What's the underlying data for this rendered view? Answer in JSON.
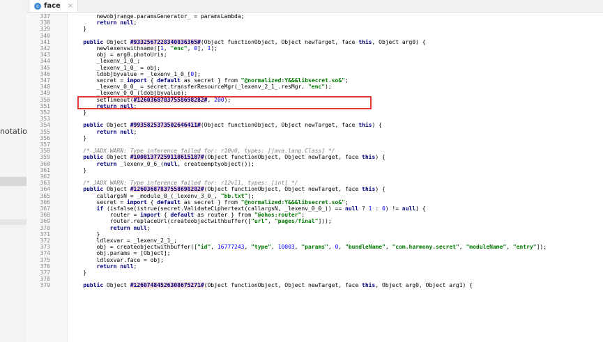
{
  "sidebar": {
    "partial_label": "notatio"
  },
  "tab": {
    "icon": "c",
    "label": "face",
    "close": "×"
  },
  "lines": [
    {
      "n": "337",
      "segs": [
        {
          "t": "        newobjrange.paramsGenerator_ = paramsLambda;",
          "c": ""
        }
      ]
    },
    {
      "n": "338",
      "segs": [
        {
          "t": "        ",
          "c": ""
        },
        {
          "t": "return null",
          "c": "kw"
        },
        {
          "t": ";",
          "c": ""
        }
      ]
    },
    {
      "n": "339",
      "segs": [
        {
          "t": "    }",
          "c": ""
        }
      ]
    },
    {
      "n": "340",
      "segs": [
        {
          "t": "",
          "c": ""
        }
      ]
    },
    {
      "n": "341",
      "segs": [
        {
          "t": "    ",
          "c": ""
        },
        {
          "t": "public",
          "c": "kw"
        },
        {
          "t": " Object ",
          "c": ""
        },
        {
          "t": "#9332567228340836365#",
          "c": "hl"
        },
        {
          "t": "(Object functionObject, Object newTarget, face ",
          "c": ""
        },
        {
          "t": "this",
          "c": "kw"
        },
        {
          "t": ", Object arg0) {",
          "c": ""
        }
      ]
    },
    {
      "n": "342",
      "segs": [
        {
          "t": "        newlexenvwithname([",
          "c": ""
        },
        {
          "t": "1",
          "c": "num"
        },
        {
          "t": ", ",
          "c": ""
        },
        {
          "t": "\"enc\"",
          "c": "str"
        },
        {
          "t": ", ",
          "c": ""
        },
        {
          "t": "0",
          "c": "num"
        },
        {
          "t": "], ",
          "c": ""
        },
        {
          "t": "1",
          "c": "num"
        },
        {
          "t": ");",
          "c": ""
        }
      ]
    },
    {
      "n": "343",
      "segs": [
        {
          "t": "        obj = arg0.photoUris;",
          "c": ""
        }
      ]
    },
    {
      "n": "344",
      "segs": [
        {
          "t": "        _lexenv_1_0_;",
          "c": ""
        }
      ]
    },
    {
      "n": "345",
      "segs": [
        {
          "t": "        _lexenv_1_0_ = obj;",
          "c": ""
        }
      ]
    },
    {
      "n": "346",
      "segs": [
        {
          "t": "        ldobjbyvalue = _lexenv_1_0_[",
          "c": ""
        },
        {
          "t": "0",
          "c": "num"
        },
        {
          "t": "];",
          "c": ""
        }
      ]
    },
    {
      "n": "347",
      "segs": [
        {
          "t": "        secret = ",
          "c": ""
        },
        {
          "t": "import",
          "c": "kw"
        },
        {
          "t": " { ",
          "c": ""
        },
        {
          "t": "default",
          "c": "kw"
        },
        {
          "t": " as secret } from ",
          "c": ""
        },
        {
          "t": "\"@normalized:Y&&&libsecret.so&\"",
          "c": "str"
        },
        {
          "t": ";",
          "c": ""
        }
      ]
    },
    {
      "n": "348",
      "segs": [
        {
          "t": "        _lexenv_0_0_ = secret.transferResourceMgr(_lexenv_2_1_.resMgr, ",
          "c": ""
        },
        {
          "t": "\"enc\"",
          "c": "str"
        },
        {
          "t": ");",
          "c": ""
        }
      ]
    },
    {
      "n": "349",
      "segs": [
        {
          "t": "        _lexenv_0_0_(ldobjbyvalue);",
          "c": ""
        }
      ]
    },
    {
      "n": "350",
      "segs": [
        {
          "t": "        setTimeout(",
          "c": ""
        },
        {
          "t": "#12603687837558698282#",
          "c": "hl"
        },
        {
          "t": ", ",
          "c": ""
        },
        {
          "t": "200",
          "c": "num"
        },
        {
          "t": ");",
          "c": ""
        }
      ]
    },
    {
      "n": "351",
      "segs": [
        {
          "t": "        ",
          "c": ""
        },
        {
          "t": "return null",
          "c": "kw"
        },
        {
          "t": ";",
          "c": ""
        }
      ]
    },
    {
      "n": "352",
      "segs": [
        {
          "t": "    }",
          "c": ""
        }
      ]
    },
    {
      "n": "353",
      "segs": [
        {
          "t": "",
          "c": ""
        }
      ]
    },
    {
      "n": "354",
      "segs": [
        {
          "t": "    ",
          "c": ""
        },
        {
          "t": "public",
          "c": "kw"
        },
        {
          "t": " Object ",
          "c": ""
        },
        {
          "t": "#9935825373502646411#",
          "c": "hl"
        },
        {
          "t": "(Object functionObject, Object newTarget, face ",
          "c": ""
        },
        {
          "t": "this",
          "c": "kw"
        },
        {
          "t": ") {",
          "c": ""
        }
      ]
    },
    {
      "n": "355",
      "segs": [
        {
          "t": "        ",
          "c": ""
        },
        {
          "t": "return null",
          "c": "kw"
        },
        {
          "t": ";",
          "c": ""
        }
      ]
    },
    {
      "n": "356",
      "segs": [
        {
          "t": "    }",
          "c": ""
        }
      ]
    },
    {
      "n": "357",
      "segs": [
        {
          "t": "",
          "c": ""
        }
      ]
    },
    {
      "n": "358",
      "segs": [
        {
          "t": "    /* JADX WARN: Type inference failed for: r10v0, types: [java.lang.Class] */",
          "c": "com"
        }
      ]
    },
    {
      "n": "359",
      "segs": [
        {
          "t": "    ",
          "c": ""
        },
        {
          "t": "public",
          "c": "kw"
        },
        {
          "t": " Object ",
          "c": ""
        },
        {
          "t": "#10081377259118615187#",
          "c": "hl"
        },
        {
          "t": "(Object functionObject, Object newTarget, face ",
          "c": ""
        },
        {
          "t": "this",
          "c": "kw"
        },
        {
          "t": ") {",
          "c": ""
        }
      ]
    },
    {
      "n": "360",
      "segs": [
        {
          "t": "        ",
          "c": ""
        },
        {
          "t": "return",
          "c": "kw"
        },
        {
          "t": " _lexenv_0_6_(",
          "c": ""
        },
        {
          "t": "null",
          "c": "kw"
        },
        {
          "t": ", createemptyobject());",
          "c": ""
        }
      ]
    },
    {
      "n": "361",
      "segs": [
        {
          "t": "    }",
          "c": ""
        }
      ]
    },
    {
      "n": "362",
      "segs": [
        {
          "t": "",
          "c": ""
        }
      ]
    },
    {
      "n": "363",
      "segs": [
        {
          "t": "    /* JADX WARN: Type inference failed for: r12v11, types: [int] */",
          "c": "com"
        }
      ]
    },
    {
      "n": "364",
      "segs": [
        {
          "t": "    ",
          "c": ""
        },
        {
          "t": "public",
          "c": "kw"
        },
        {
          "t": " Object ",
          "c": ""
        },
        {
          "t": "#12603687837558698282#",
          "c": "hl"
        },
        {
          "t": "(Object functionObject, Object newTarget, face ",
          "c": ""
        },
        {
          "t": "this",
          "c": "kw"
        },
        {
          "t": ") {",
          "c": ""
        }
      ]
    },
    {
      "n": "365",
      "segs": [
        {
          "t": "        callargsN = _module_0_(_lexenv_3_0_, ",
          "c": ""
        },
        {
          "t": "\"bb.txt\"",
          "c": "str"
        },
        {
          "t": ");",
          "c": ""
        }
      ]
    },
    {
      "n": "366",
      "segs": [
        {
          "t": "        secret = ",
          "c": ""
        },
        {
          "t": "import",
          "c": "kw"
        },
        {
          "t": " { ",
          "c": ""
        },
        {
          "t": "default",
          "c": "kw"
        },
        {
          "t": " as secret } from ",
          "c": ""
        },
        {
          "t": "\"@normalized:Y&&&libsecret.so&\"",
          "c": "str"
        },
        {
          "t": ";",
          "c": ""
        }
      ]
    },
    {
      "n": "367",
      "segs": [
        {
          "t": "        ",
          "c": ""
        },
        {
          "t": "if",
          "c": "kw"
        },
        {
          "t": " (isfalse(istrue(secret.ValidateCiphertext(callargsN, _lexenv_0_0_)) == ",
          "c": ""
        },
        {
          "t": "null",
          "c": "kw"
        },
        {
          "t": " ? ",
          "c": ""
        },
        {
          "t": "1",
          "c": "num"
        },
        {
          "t": " : ",
          "c": ""
        },
        {
          "t": "0",
          "c": "num"
        },
        {
          "t": ") != ",
          "c": ""
        },
        {
          "t": "null",
          "c": "kw"
        },
        {
          "t": ") {",
          "c": ""
        }
      ]
    },
    {
      "n": "368",
      "segs": [
        {
          "t": "            router = ",
          "c": ""
        },
        {
          "t": "import",
          "c": "kw"
        },
        {
          "t": " { ",
          "c": ""
        },
        {
          "t": "default",
          "c": "kw"
        },
        {
          "t": " as router } from ",
          "c": ""
        },
        {
          "t": "\"@ohos:router\"",
          "c": "str"
        },
        {
          "t": ";",
          "c": ""
        }
      ]
    },
    {
      "n": "369",
      "segs": [
        {
          "t": "            router.replaceUrl(createobjectwithbuffer([",
          "c": ""
        },
        {
          "t": "\"url\"",
          "c": "str"
        },
        {
          "t": ", ",
          "c": ""
        },
        {
          "t": "\"pages/final\"",
          "c": "str"
        },
        {
          "t": "]));",
          "c": ""
        }
      ]
    },
    {
      "n": "370",
      "segs": [
        {
          "t": "            ",
          "c": ""
        },
        {
          "t": "return null",
          "c": "kw"
        },
        {
          "t": ";",
          "c": ""
        }
      ]
    },
    {
      "n": "371",
      "segs": [
        {
          "t": "        }",
          "c": ""
        }
      ]
    },
    {
      "n": "372",
      "segs": [
        {
          "t": "        ldlexvar = _lexenv_2_1_;",
          "c": ""
        }
      ]
    },
    {
      "n": "373",
      "segs": [
        {
          "t": "        obj = createobjectwithbuffer([",
          "c": ""
        },
        {
          "t": "\"id\"",
          "c": "str"
        },
        {
          "t": ", ",
          "c": ""
        },
        {
          "t": "16777243",
          "c": "num"
        },
        {
          "t": ", ",
          "c": ""
        },
        {
          "t": "\"type\"",
          "c": "str"
        },
        {
          "t": ", ",
          "c": ""
        },
        {
          "t": "10003",
          "c": "num"
        },
        {
          "t": ", ",
          "c": ""
        },
        {
          "t": "\"params\"",
          "c": "str"
        },
        {
          "t": ", ",
          "c": ""
        },
        {
          "t": "0",
          "c": "num"
        },
        {
          "t": ", ",
          "c": ""
        },
        {
          "t": "\"bundleName\"",
          "c": "str"
        },
        {
          "t": ", ",
          "c": ""
        },
        {
          "t": "\"com.harmony.secret\"",
          "c": "str"
        },
        {
          "t": ", ",
          "c": ""
        },
        {
          "t": "\"moduleName\"",
          "c": "str"
        },
        {
          "t": ", ",
          "c": ""
        },
        {
          "t": "\"entry\"",
          "c": "str"
        },
        {
          "t": "]);",
          "c": ""
        }
      ]
    },
    {
      "n": "374",
      "segs": [
        {
          "t": "        obj.params = [Object];",
          "c": ""
        }
      ]
    },
    {
      "n": "375",
      "segs": [
        {
          "t": "        ldlexvar.face = obj;",
          "c": ""
        }
      ]
    },
    {
      "n": "376",
      "segs": [
        {
          "t": "        ",
          "c": ""
        },
        {
          "t": "return null",
          "c": "kw"
        },
        {
          "t": ";",
          "c": ""
        }
      ]
    },
    {
      "n": "377",
      "segs": [
        {
          "t": "    }",
          "c": ""
        }
      ]
    },
    {
      "n": "378",
      "segs": [
        {
          "t": "",
          "c": ""
        }
      ]
    },
    {
      "n": "379",
      "segs": [
        {
          "t": "    ",
          "c": ""
        },
        {
          "t": "public",
          "c": "kw"
        },
        {
          "t": " Object ",
          "c": ""
        },
        {
          "t": "#12607484526308675271#",
          "c": "hl"
        },
        {
          "t": "(Object functionObject, Object newTarget, face ",
          "c": ""
        },
        {
          "t": "this",
          "c": "kw"
        },
        {
          "t": ", Object arg0, Object arg1) {",
          "c": ""
        }
      ]
    }
  ]
}
